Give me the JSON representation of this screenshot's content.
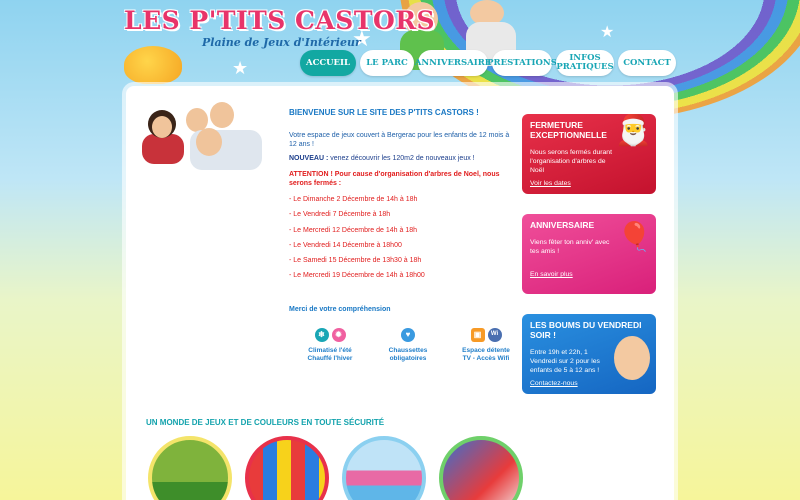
{
  "header": {
    "logo_title": "LES P'TITS CASTORS",
    "logo_subtitle": "Plaine de Jeux d'Intérieur"
  },
  "nav": {
    "items": [
      {
        "label": "ACCUEIL",
        "active": true
      },
      {
        "label": "LE PARC",
        "active": false
      },
      {
        "label": "ANNIVERSAIRE",
        "active": false
      },
      {
        "label": "PRESTATIONS",
        "active": false
      },
      {
        "label": "INFOS PRATIQUES",
        "active": false
      },
      {
        "label": "CONTACT",
        "active": false
      }
    ]
  },
  "main": {
    "welcome": "BIENVENUE SUR LE SITE DES P'TITS CASTORS !",
    "intro": "Votre espace de jeux couvert à Bergerac pour les enfants de 12 mois à 12 ans !",
    "nouveau_label": "NOUVEAU :",
    "nouveau_text": "venez découvrir les 120m2 de nouveaux jeux !",
    "attention": "ATTENTION ! Pour cause d'organisation d'arbres de Noel, nous serons fermés :",
    "dates": [
      "- Le Dimanche 2 Décembre de 14h à 18h",
      "- Le Vendredi 7 Décembre à 18h",
      "- Le Mercredi 12 Décembre de 14h à 18h",
      "- Le Vendredi 14 Décembre à 18h00",
      "- Le Samedi 15 Décembre de 13h30 à 18h",
      "- Le Mercredi 19 Décembre de 14h à 18h00"
    ],
    "merci": "Merci de votre compréhension"
  },
  "features": [
    {
      "line1": "Climatisé l'été",
      "line2": "Chauffé l'hiver",
      "icons": [
        "snowflake-icon",
        "sun-icon"
      ]
    },
    {
      "line1": "Chaussettes",
      "line2": "obligatoires",
      "icons": [
        "sock-icon"
      ]
    },
    {
      "line1": "Espace détente",
      "line2": "TV - Accès Wifi",
      "icons": [
        "tv-icon",
        "wifi-icon"
      ]
    }
  ],
  "feature_icon_labels": {
    "wifi": "Wi"
  },
  "promos": [
    {
      "title": "FERMETURE EXCEPTIONNELLE",
      "text": "Nous serons fermés durant l'organisation d'arbres de Noël",
      "link": "Voir les dates"
    },
    {
      "title": "ANNIVERSAIRE",
      "text": "Viens fêter ton anniv' avec tes amis !",
      "link": "En savoir plus"
    },
    {
      "title": "LES BOUMS DU VENDREDI SOIR !",
      "text": "Entre 19h et 22h, 1 Vendredi sur 2 pour les enfants de 5 à 12 ans !",
      "link": "Contactez-nous"
    }
  ],
  "section": {
    "title": "UN MONDE DE JEUX ET DE COULEURS EN TOUTE SÉCURITÉ"
  },
  "colors": {
    "accent_teal": "#12a8a2",
    "brand_pink": "#e8346a",
    "alert_red": "#e11d1d",
    "link_blue": "#1978c4"
  }
}
